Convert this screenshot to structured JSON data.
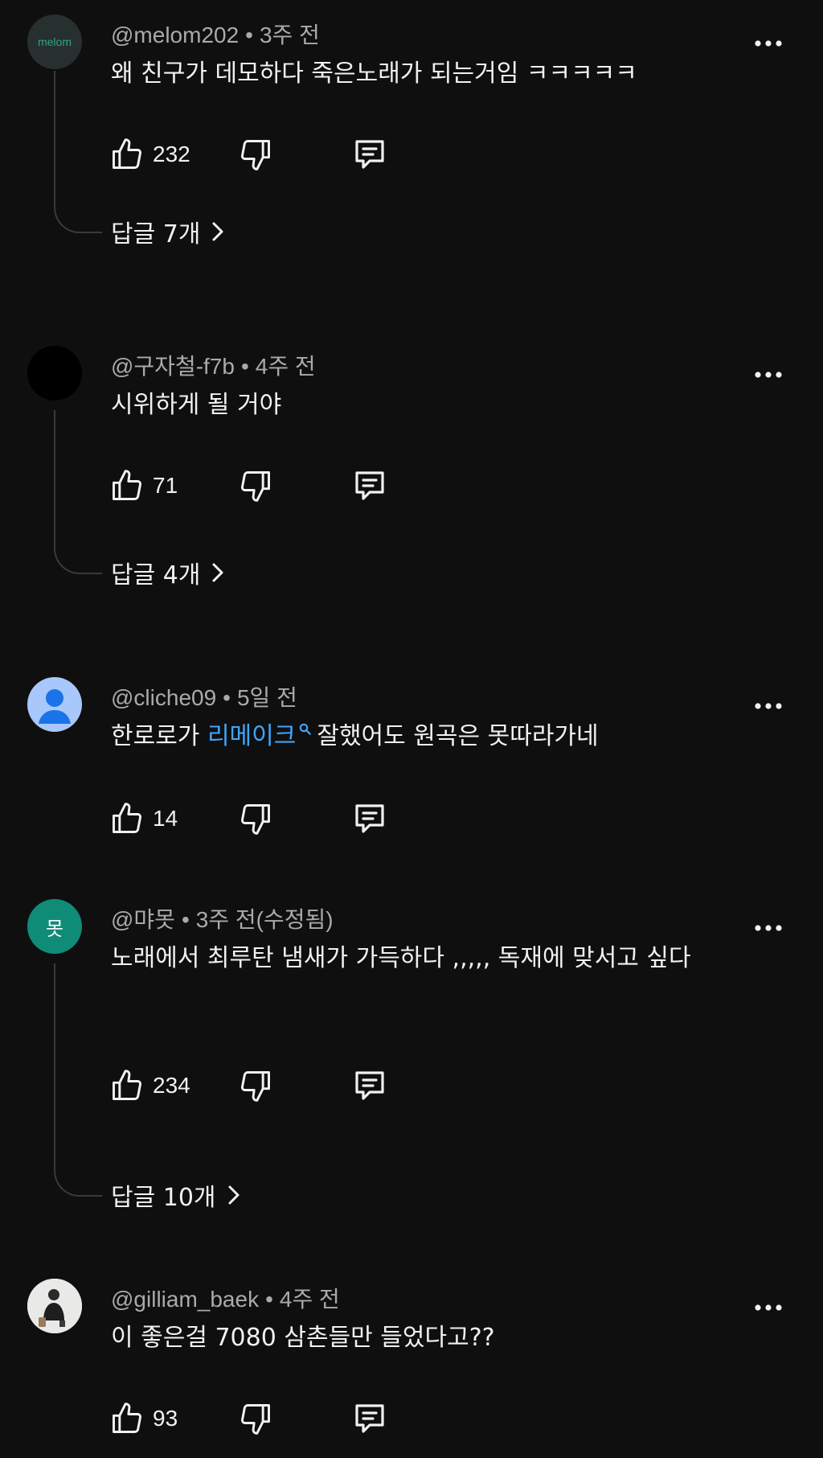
{
  "comments": [
    {
      "author": "@melom202",
      "time": "3주 전",
      "avatar_text": "melom",
      "text": "왜 친구가 데모하다 죽은노래가 되는거임 ㅋㅋㅋㅋㅋ",
      "likes": "232",
      "replies_label": "답글 7개"
    },
    {
      "author": "@구자철-f7b",
      "time": "4주 전",
      "text": "시위하게 될 거야",
      "likes": "71",
      "replies_label": "답글 4개"
    },
    {
      "author": "@cliche09",
      "time": "5일 전",
      "text_before": "한로로가 ",
      "text_link": "리메이크",
      "text_after": "잘했어도 원곡은 못따라가네",
      "likes": "14"
    },
    {
      "author": "@먀못",
      "time": "3주 전(수정됨)",
      "avatar_text": "못",
      "text": "노래에서 최루탄 냄새가 가득하다 ,,,,, 독재에 맞서고 싶다",
      "likes": "234",
      "replies_label": "답글 10개"
    },
    {
      "author": "@gilliam_baek",
      "time": "4주 전",
      "text": "이 좋은걸 7080 삼촌들만 들었다고??",
      "likes": "93"
    }
  ],
  "separator": "•",
  "colors": {
    "background": "#0f0f0f",
    "text": "#f1f1f1",
    "meta": "#aaaaaa",
    "link": "#3ea6ff"
  },
  "icons": {
    "like": "thumbs-up-icon",
    "dislike": "thumbs-down-icon",
    "reply": "comment-icon",
    "more": "more-vertical-dots-icon",
    "expand": "chevron-right-icon",
    "search": "search-icon"
  }
}
